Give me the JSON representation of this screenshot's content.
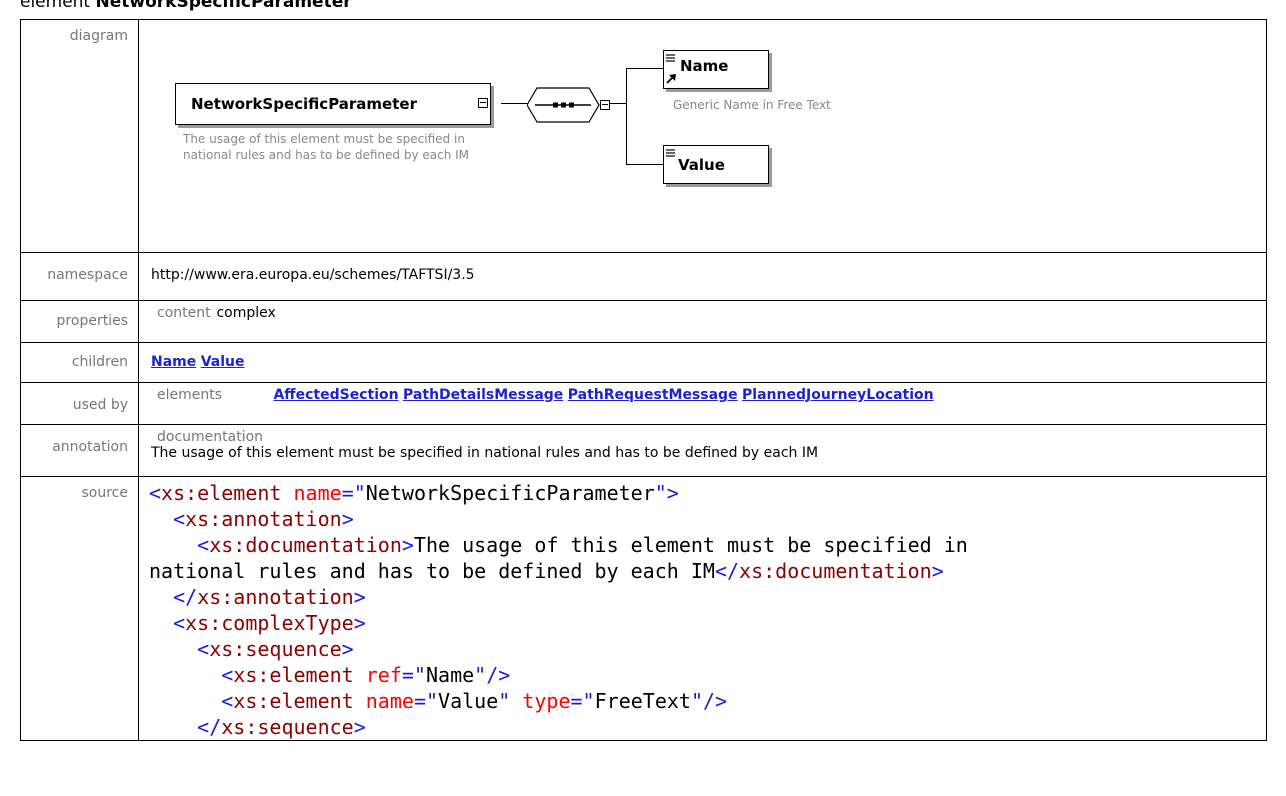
{
  "page": {
    "title_prefix": "element ",
    "title_name": "NetworkSpecificParameter"
  },
  "diagram": {
    "label": "diagram",
    "main_element": "NetworkSpecificParameter",
    "main_note": "The usage of this element must be specified in national rules and has to be defined by each IM",
    "child_name": "Name",
    "child_name_note": "Generic Name in Free Text",
    "child_value": "Value"
  },
  "namespace": {
    "label": "namespace",
    "value": "http://www.era.europa.eu/schemes/TAFTSI/3.5"
  },
  "properties": {
    "label": "properties",
    "key": "content",
    "value": "complex"
  },
  "children": {
    "label": "children",
    "items": [
      "Name",
      "Value"
    ]
  },
  "used_by": {
    "label": "used by",
    "key": "elements",
    "items": [
      "AffectedSection",
      "PathDetailsMessage",
      "PathRequestMessage",
      "PlannedJourneyLocation"
    ]
  },
  "annotation": {
    "label": "annotation",
    "key": "documentation",
    "text": "The usage of this element must be specified in national rules and has to be defined by each IM"
  },
  "source": {
    "label": "source",
    "element_name": "NetworkSpecificParameter",
    "doc_line1": "The usage of this element must be specified in",
    "doc_line2": "national rules and has to be defined by each IM",
    "ref_value": "Name",
    "value_name": "Value",
    "value_type": "FreeText"
  }
}
